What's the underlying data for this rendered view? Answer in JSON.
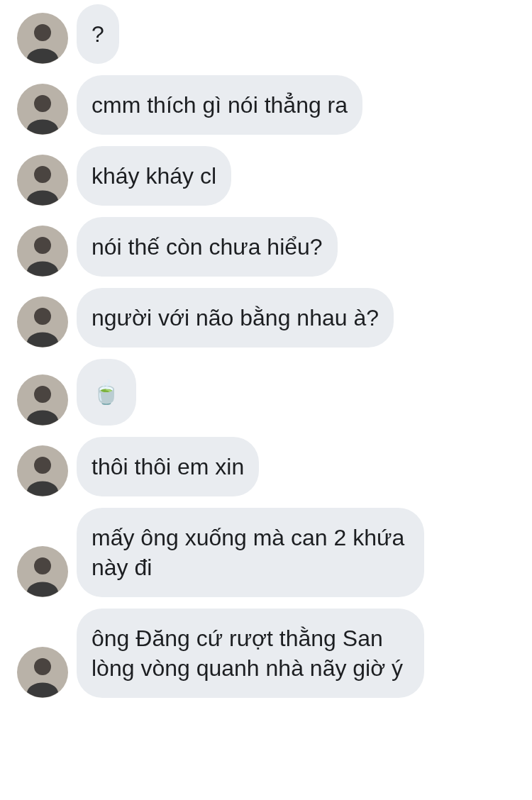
{
  "messages": [
    {
      "kind": "text",
      "text": "?"
    },
    {
      "kind": "text",
      "text": "cmm thích gì nói thẳng ra"
    },
    {
      "kind": "text",
      "text": "kháy kháy cl"
    },
    {
      "kind": "text",
      "text": "nói thế còn chưa hiểu?"
    },
    {
      "kind": "text",
      "text": "người với não bằng nhau à?"
    },
    {
      "kind": "emoji",
      "text": "🍵"
    },
    {
      "kind": "text",
      "text": "thôi thôi em xin"
    },
    {
      "kind": "text",
      "text": "mấy ông xuống mà can 2 khứa này đi"
    },
    {
      "kind": "text",
      "text": "ông Đăng cứ rượt thằng San lòng vòng quanh nhà nãy giờ ý"
    }
  ]
}
